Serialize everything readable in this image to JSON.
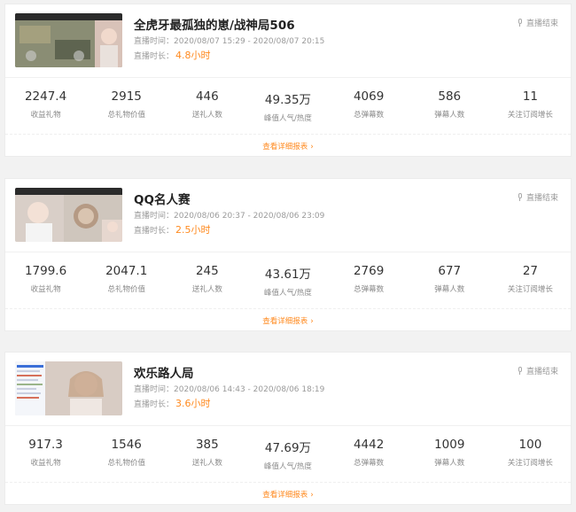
{
  "status_label": "直播结束",
  "time_prefix": "直播时间：",
  "duration_prefix": "直播时长：",
  "report_label": "查看详细报表",
  "stat_labels": [
    "收益礼物",
    "总礼物价值",
    "送礼人数",
    "峰值人气/热度",
    "总弹幕数",
    "弹幕人数",
    "关注订阅增长"
  ],
  "sessions": [
    {
      "title": "全虎牙最孤独的崽/战神局506",
      "time_range": "2020/08/07 15:29 - 2020/08/07 20:15",
      "duration": "4.8小时",
      "stats": [
        "2247.4",
        "2915",
        "446",
        "49.35万",
        "4069",
        "586",
        "11"
      ]
    },
    {
      "title": "QQ名人赛",
      "time_range": "2020/08/06 20:37 - 2020/08/06 23:09",
      "duration": "2.5小时",
      "stats": [
        "1799.6",
        "2047.1",
        "245",
        "43.61万",
        "2769",
        "677",
        "27"
      ]
    },
    {
      "title": "欢乐路人局",
      "time_range": "2020/08/06 14:43 - 2020/08/06 18:19",
      "duration": "3.6小时",
      "stats": [
        "917.3",
        "1546",
        "385",
        "47.69万",
        "4442",
        "1009",
        "100"
      ]
    }
  ],
  "colors": {
    "accent": "#ff8a1f",
    "muted": "#9a9a9a"
  }
}
